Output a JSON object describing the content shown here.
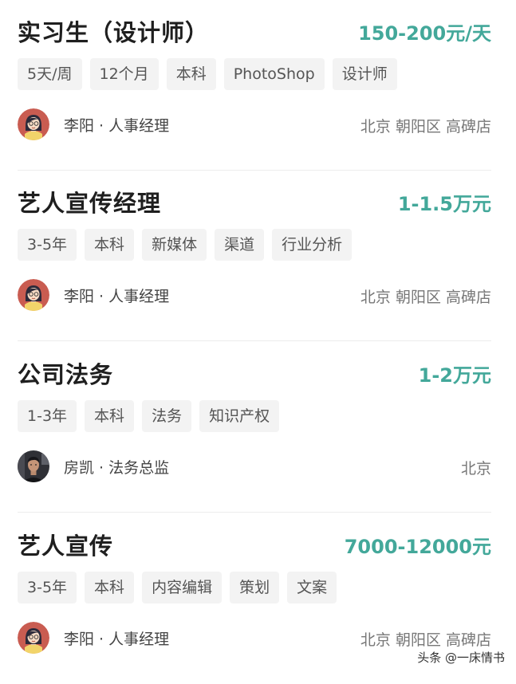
{
  "jobs": [
    {
      "title": "实习生（设计师）",
      "salary": "150-200元/天",
      "tags": [
        "5天/周",
        "12个月",
        "本科",
        "PhotoShop",
        "设计师"
      ],
      "recruiter": "李阳 · 人事经理",
      "location": "北京 朝阳区 高碑店",
      "avatar": "female-cartoon-avatar"
    },
    {
      "title": "艺人宣传经理",
      "salary": "1-1.5万元",
      "tags": [
        "3-5年",
        "本科",
        "新媒体",
        "渠道",
        "行业分析"
      ],
      "recruiter": "李阳 · 人事经理",
      "location": "北京 朝阳区 高碑店",
      "avatar": "female-cartoon-avatar"
    },
    {
      "title": "公司法务",
      "salary": "1-2万元",
      "tags": [
        "1-3年",
        "本科",
        "法务",
        "知识产权"
      ],
      "recruiter": "房凯 · 法务总监",
      "location": "北京",
      "avatar": "male-photo-avatar"
    },
    {
      "title": "艺人宣传",
      "salary": "7000-12000元",
      "tags": [
        "3-5年",
        "本科",
        "内容编辑",
        "策划",
        "文案"
      ],
      "recruiter": "李阳 · 人事经理",
      "location": "北京 朝阳区 高碑店",
      "avatar": "female-cartoon-avatar"
    }
  ],
  "watermark": "头条 @一床情书",
  "colors": {
    "salary": "#43a89a",
    "tag_bg": "#f3f3f3",
    "avatar_bg": "#c95c51"
  }
}
